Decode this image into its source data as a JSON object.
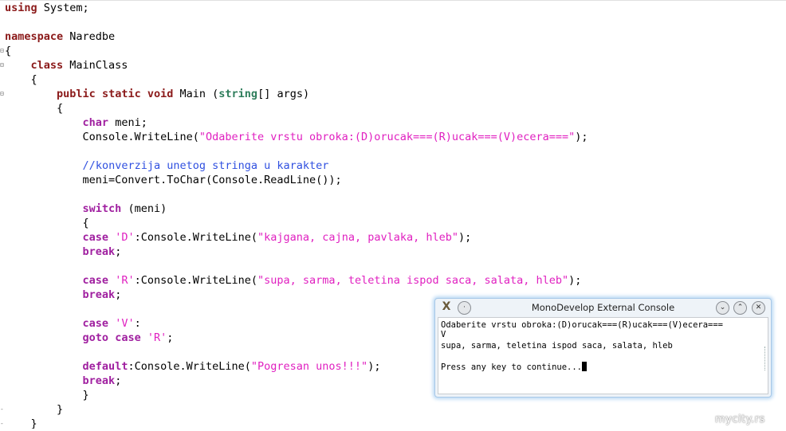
{
  "editor": {
    "fold_markers": {
      "minus": "⊟",
      "end": "-"
    },
    "lines": {
      "l1_kw": "using",
      "l1_rest": " System;",
      "l3_kw": "namespace",
      "l3_rest": " Naredbe",
      "l4": "{",
      "l5_indent": "    ",
      "l5_kw": "class",
      "l5_rest": " MainClass",
      "l6": "    {",
      "l7_indent": "        ",
      "l7_kw1": "public",
      "l7_kw2": "static",
      "l7_kw3": "void",
      "l7_mid": " Main (",
      "l7_type": "string",
      "l7_rest": "[] args)",
      "l8": "        {",
      "l9_indent": "            ",
      "l9_kw": "char",
      "l9_rest": " meni;",
      "l10_pre": "            Console.WriteLine(",
      "l10_str": "\"Odaberite vrstu obroka:(D)orucak===(R)ucak===(V)ecera===\"",
      "l10_post": ");",
      "l12_indent": "            ",
      "l12_cmt_slash": "//",
      "l12_cmt": "konverzija unetog stringa u karakter",
      "l13": "            meni=Convert.ToChar(Console.ReadLine());",
      "l15_indent": "            ",
      "l15_kw": "switch",
      "l15_rest": " (meni)",
      "l16": "            {",
      "l17_indent": "            ",
      "l17_kw": "case",
      "l17_sp": " ",
      "l17_str": "'D'",
      "l17_mid": ":Console.WriteLine(",
      "l17_str2": "\"kajgana, cajna, pavlaka, hleb\"",
      "l17_post": ");",
      "l18_indent": "            ",
      "l18_kw": "break",
      "l18_rest": ";",
      "l20_indent": "            ",
      "l20_kw": "case",
      "l20_sp": " ",
      "l20_str": "'R'",
      "l20_mid": ":Console.WriteLine(",
      "l20_str2": "\"supa, sarma, teletina ispod saca, salata, hleb\"",
      "l20_post": ");",
      "l21_indent": "            ",
      "l21_kw": "break",
      "l21_rest": ";",
      "l23_indent": "            ",
      "l23_kw": "case",
      "l23_sp": " ",
      "l23_str": "'V'",
      "l23_rest": ":",
      "l24_indent": "            ",
      "l24_kw1": "goto",
      "l24_sp": " ",
      "l24_kw2": "case",
      "l24_sp2": " ",
      "l24_str": "'R'",
      "l24_rest": ";",
      "l26_indent": "            ",
      "l26_kw": "default",
      "l26_mid": ":Console.WriteLine(",
      "l26_str": "\"Pogresan unos!!!\"",
      "l26_post": ");",
      "l27_indent": "            ",
      "l27_kw": "break",
      "l27_rest": ";",
      "l28": "            }",
      "l29": "        }",
      "l30": "    }"
    }
  },
  "console": {
    "title": "MonoDevelop External Console",
    "menu_icon": "X",
    "sticky_icon": "·",
    "minimize_icon": "⌄",
    "maximize_icon": "⌃",
    "close_icon": "✕",
    "output": [
      "Odaberite vrstu obroka:(D)orucak===(R)ucak===(V)ecera===",
      "V",
      "supa, sarma, teletina ispod saca, salata, hleb",
      "",
      "Press any key to continue..."
    ]
  },
  "watermark": "mycity.rs",
  "colors": {
    "keyword_red": "#8b1a1a",
    "keyword_purple": "#a020a0",
    "keyword_green": "#2e7d5b",
    "string": "#e020c0",
    "comment": "#3050e0",
    "console_glow": "#b8d8f4"
  }
}
